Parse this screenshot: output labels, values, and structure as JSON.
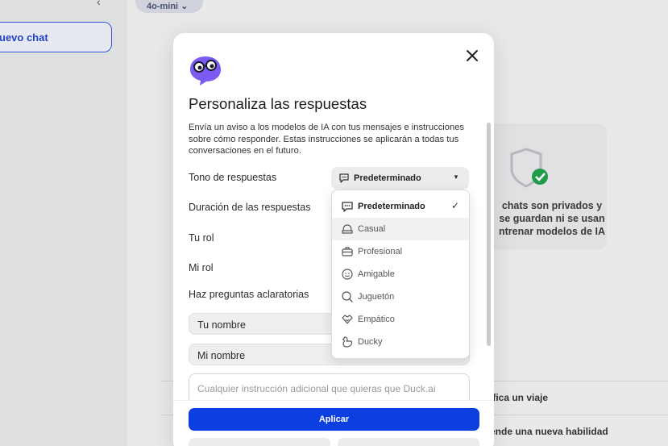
{
  "background": {
    "new_chat_label": "uevo chat",
    "model_label": "4o-mini",
    "privacy_text": "chats son privados y\nse guardan ni se usan\nntrenar modelos de IA",
    "suggestions": [
      "ifica un viaje",
      "ende una nueva habilidad"
    ]
  },
  "modal": {
    "title": "Personaliza las respuestas",
    "description": "Envía un aviso a los modelos de IA con tus mensajes e instrucciones sobre cómo responder. Estas instrucciones se aplicarán a todas tus conversaciones en el futuro.",
    "rows": {
      "tone": "Tono de respuestas",
      "length": "Duración de las respuestas",
      "your_role": "Tu rol",
      "my_role": "Mi rol",
      "clarifying": "Haz preguntas aclaratorias"
    },
    "tone_selected": "Predeterminado",
    "your_name_placeholder": "Tu nombre",
    "my_name_placeholder": "Mi nombre",
    "instructions_placeholder": "Cualquier instrucción adicional que quieras que Duck.ai",
    "apply_label": "Aplicar"
  },
  "dropdown": {
    "options": [
      {
        "label": "Predeterminado",
        "icon": "chat-bubble-icon",
        "selected": true
      },
      {
        "label": "Casual",
        "icon": "casual-icon",
        "selected": false
      },
      {
        "label": "Profesional",
        "icon": "briefcase-icon",
        "selected": false
      },
      {
        "label": "Amigable",
        "icon": "smile-icon",
        "selected": false
      },
      {
        "label": "Juguetón",
        "icon": "playful-icon",
        "selected": false
      },
      {
        "label": "Empático",
        "icon": "handshake-icon",
        "selected": false
      },
      {
        "label": "Ducky",
        "icon": "duck-icon",
        "selected": false
      }
    ]
  },
  "colors": {
    "accent": "#0b3fe0",
    "logo_purple": "#7b5bf2",
    "check_green": "#1f9b4a"
  }
}
